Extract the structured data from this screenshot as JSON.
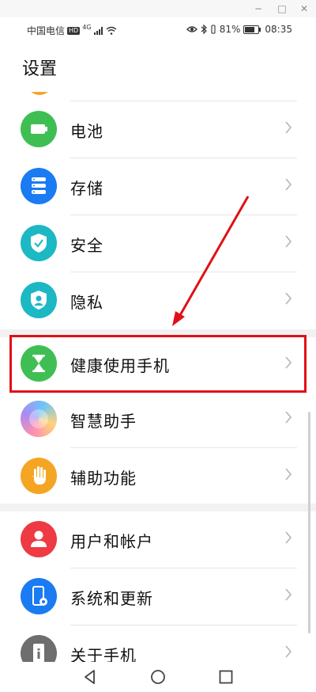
{
  "window": {
    "minimize": "−",
    "maximize": "□",
    "close": "✕"
  },
  "status": {
    "carrier": "中国电信",
    "hd": "HD",
    "network": "4G",
    "signal_icon": "signal-icon",
    "wifi_icon": "wifi-icon",
    "battery_percent": "81%",
    "battery_level": 0.81,
    "time": "08:35"
  },
  "header": {
    "title": "设置"
  },
  "items": [
    {
      "label": "电池",
      "icon": "battery-icon",
      "color": "#3fbf53"
    },
    {
      "label": "存储",
      "icon": "storage-icon",
      "color": "#1a7bf2"
    },
    {
      "label": "安全",
      "icon": "shield-icon",
      "color": "#1cb8c4"
    },
    {
      "label": "隐私",
      "icon": "privacy-icon",
      "color": "#1cb8c4"
    },
    {
      "label": "健康使用手机",
      "icon": "hourglass-icon",
      "color": "#3fbf53"
    },
    {
      "label": "智慧助手",
      "icon": "assistant-icon",
      "color": "#a98cf2"
    },
    {
      "label": "辅助功能",
      "icon": "hand-icon",
      "color": "#f5a524"
    },
    {
      "label": "用户和帐户",
      "icon": "user-icon",
      "color": "#ee3a43"
    },
    {
      "label": "系统和更新",
      "icon": "system-update-icon",
      "color": "#1a7bf2"
    },
    {
      "label": "关于手机",
      "icon": "info-icon",
      "color": "#6e6e6e"
    }
  ],
  "colors": {
    "highlight": "#e11016",
    "arrow": "#e11016"
  }
}
